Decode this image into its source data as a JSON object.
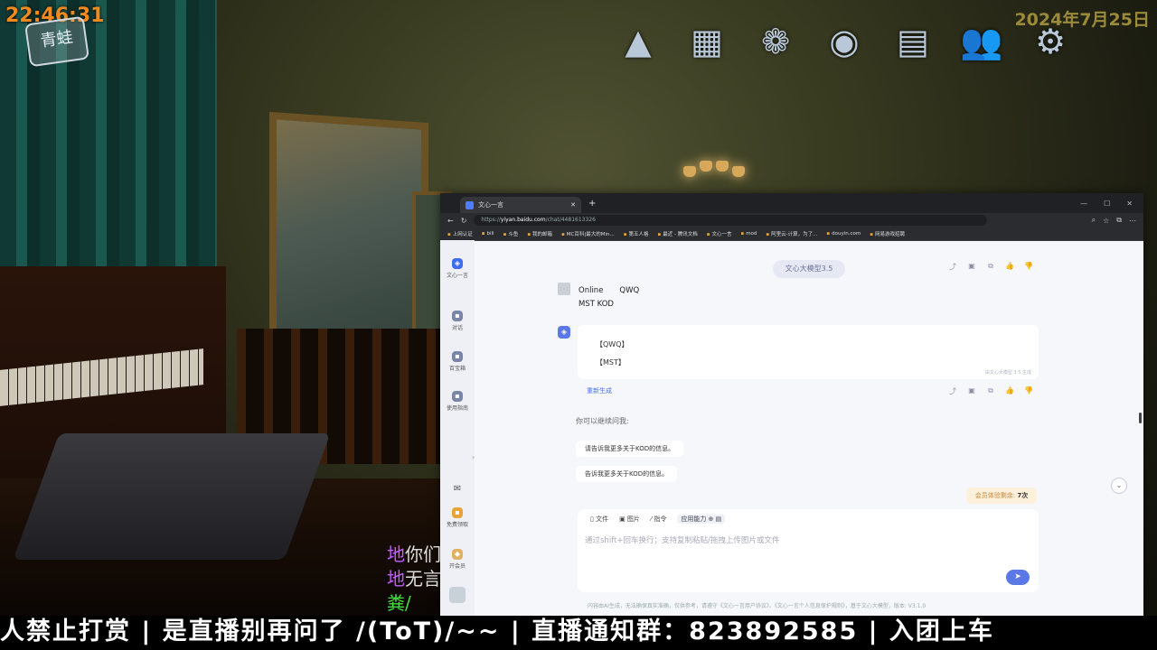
{
  "overlay": {
    "clock": "22:46:31",
    "date": "2024年7月25日",
    "logo_text": "青蛙",
    "top_icons": [
      "triangle-icon",
      "map-icon",
      "frame-icon",
      "portrait-icon",
      "notice-board-icon",
      "friends-icon",
      "settings-gear-icon"
    ],
    "ticker": "人禁止打赏 | 是直播别再问了 /(ToT)/~~ | 直播通知群：823892585  | 入团上车",
    "chat_lines": [
      {
        "prefix": "地",
        "text": "你们",
        "color": "#c060ff"
      },
      {
        "prefix": "地",
        "text": "无言",
        "color": "#c060ff"
      },
      {
        "prefix": "",
        "text": "粪/",
        "color": "#40e040"
      }
    ]
  },
  "browser": {
    "tab_title": "文心一言",
    "url_prefix": "https://",
    "url_domain": "yiyan.baidu.com",
    "url_path": "/chat/4481613326",
    "bookmarks": [
      "上网认证",
      "bili",
      "斗鱼",
      "我的邮箱",
      "MC百科|最大的Min...",
      "第五人格",
      "最近 - 腾讯文档",
      "文心一言",
      "mod",
      "阿里云-计算，为了...",
      "douyin.com",
      "网易游戏招聘"
    ],
    "window_controls": [
      "—",
      "☐",
      "✕"
    ]
  },
  "sidebar": {
    "brand": "文心一言",
    "items": [
      {
        "label": "对话",
        "icon": "chat-icon"
      },
      {
        "label": "百宝箱",
        "icon": "toolbox-icon"
      },
      {
        "label": "使用指南",
        "icon": "guide-icon"
      }
    ],
    "bottom": [
      {
        "label": "",
        "icon": "mail-icon"
      },
      {
        "label": "免费领取",
        "icon": "gift-icon"
      },
      {
        "label": "开会员",
        "icon": "vip-icon"
      },
      {
        "label": "",
        "icon": "user-avatar"
      }
    ]
  },
  "chat": {
    "model_label": "文心大模型3.5",
    "user_message_line1_a": "Online",
    "user_message_line1_b": "QWQ",
    "user_message_line2": "MST KOD",
    "bot_line1": "【QWQ】",
    "bot_line2": "【MST】",
    "bot_footnote": "由文心大模型 3.5 生成",
    "regenerate": "重新生成",
    "suggest_title": "你可以继续问我:",
    "suggestions": [
      "请告诉我更多关于KOD的信息。",
      "告诉我更多关于KOD的信息。"
    ],
    "trial_label": "会员体验剩余:",
    "trial_count": "7次"
  },
  "composer": {
    "tools": [
      "文件",
      "图片",
      "指令",
      "应用能力"
    ],
    "placeholder": "通过shift+回车换行；支持复制粘贴/拖拽上传图片或文件",
    "footer": "内容由AI生成，无法确保真实准确，仅供参考，请遵守《文心一言用户协议》、《文心一言个人信息保护规则》，基于文心大模型，版本: V3.1.0"
  }
}
